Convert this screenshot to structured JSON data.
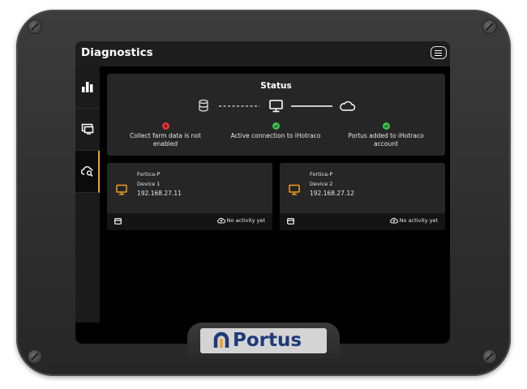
{
  "header": {
    "title": "Diagnostics"
  },
  "sidebar": {
    "items": [
      {
        "icon": "bar-chart-icon"
      },
      {
        "icon": "monitor-icon"
      },
      {
        "icon": "cloud-search-icon",
        "active": true
      }
    ]
  },
  "status": {
    "title": "Status",
    "items": [
      {
        "label": "Collect farm data is not enabled",
        "state": "error",
        "color": "#e0353a"
      },
      {
        "label": "Active connection to iHotraco",
        "state": "ok",
        "color": "#3fbf4f"
      },
      {
        "label": "Portus added to iHotraco account",
        "state": "ok",
        "color": "#3fbf4f"
      }
    ]
  },
  "devices": [
    {
      "model": "Fortica-P",
      "name": "Device 1",
      "ip": "192.168.27.11",
      "activity": "No activity yet"
    },
    {
      "model": "Fortica-P",
      "name": "Device 2",
      "ip": "192.168.27.12",
      "activity": "No activity yet"
    }
  ],
  "brand": {
    "name": "Portus",
    "color": "#1e3a78",
    "accent": "#f0a020"
  }
}
